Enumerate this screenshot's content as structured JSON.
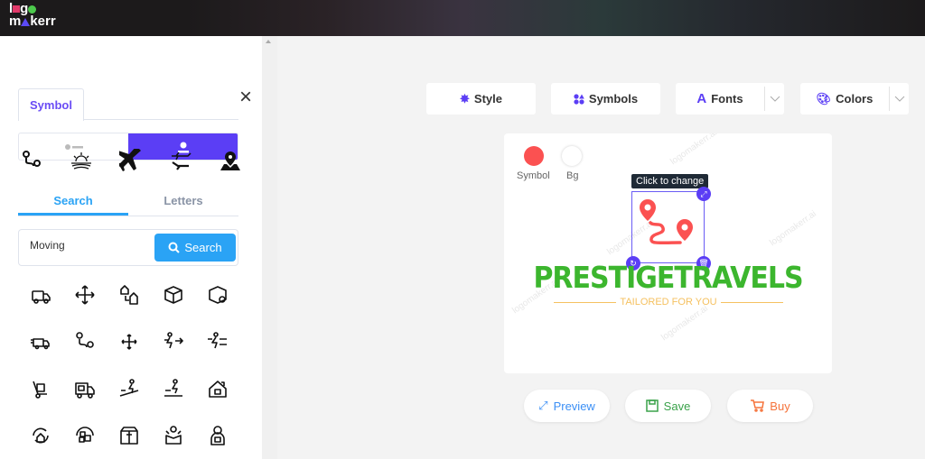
{
  "header": {
    "logo_text": "logo makerr"
  },
  "panel": {
    "tab_label": "Symbol",
    "toggle": {
      "selected": "icon"
    },
    "search_tabs": [
      {
        "label": "Search",
        "active": true
      },
      {
        "label": "Letters",
        "active": false
      }
    ],
    "search": {
      "value": "Moving",
      "button_label": "Search"
    },
    "recent_icons": [
      "route-icon",
      "sunrise-fields-icon",
      "airplane-icon",
      "airplanes-icon",
      "map-pin-icon"
    ],
    "results_icons": [
      "delivery-truck-icon",
      "move-arrows-icon",
      "house-moving-icon",
      "box-delivery-icon",
      "package-icon",
      "fast-delivery-icon",
      "route-icon",
      "move-arrows-icon",
      "runner-icon",
      "runner-fast-icon",
      "hand-truck-icon",
      "moving-truck-icon",
      "runner-stairs-icon",
      "runner-line-icon",
      "house-hand-icon",
      "house-cycle-icon",
      "boxes-icon",
      "box-open-icon",
      "person-box-icon",
      "delivery-man-icon"
    ]
  },
  "toolbar": {
    "style": "Style",
    "symbols": "Symbols",
    "fonts": "Fonts",
    "colors": "Colors"
  },
  "canvas": {
    "symbol_label": "Symbol",
    "bg_label": "Bg",
    "symbol_color": "#fb5151",
    "bg_color": "#ffffff",
    "tooltip": "Click to change",
    "brand_name": "PRESTIGETRAVELS",
    "brand_color": "#3cb62e",
    "tagline": "TAILORED FOR YOU",
    "tagline_color": "#f5c160",
    "watermark": "logomakerr.ai"
  },
  "actions": {
    "preview": "Preview",
    "save": "Save",
    "buy": "Buy"
  }
}
